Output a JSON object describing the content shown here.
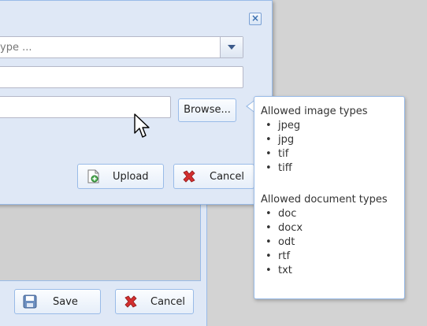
{
  "dialog": {
    "combo_text": "ype ...",
    "browse_label": "Browse...",
    "upload_label": "Upload",
    "cancel_label": "Cancel"
  },
  "background_form": {
    "save_label": "Save",
    "cancel_label": "Cancel"
  },
  "tooltip": {
    "image_heading": "Allowed image types",
    "image_types": [
      "jpeg",
      "jpg",
      "tif",
      "tiff"
    ],
    "document_heading": "Allowed document types",
    "document_types": [
      "doc",
      "docx",
      "odt",
      "rtf",
      "txt"
    ],
    "bullet": "•"
  },
  "icons": {
    "close": "close-icon",
    "dropdown": "chevron-down-icon",
    "upload": "upload-icon",
    "cancel": "cancel-icon",
    "save": "save-icon",
    "cursor": "mouse-pointer-icon"
  },
  "colors": {
    "window_bg": "#dfe8f6",
    "border": "#99bbe8",
    "desktop": "#d3d3d3",
    "cancel_red": "#d32f2f"
  }
}
